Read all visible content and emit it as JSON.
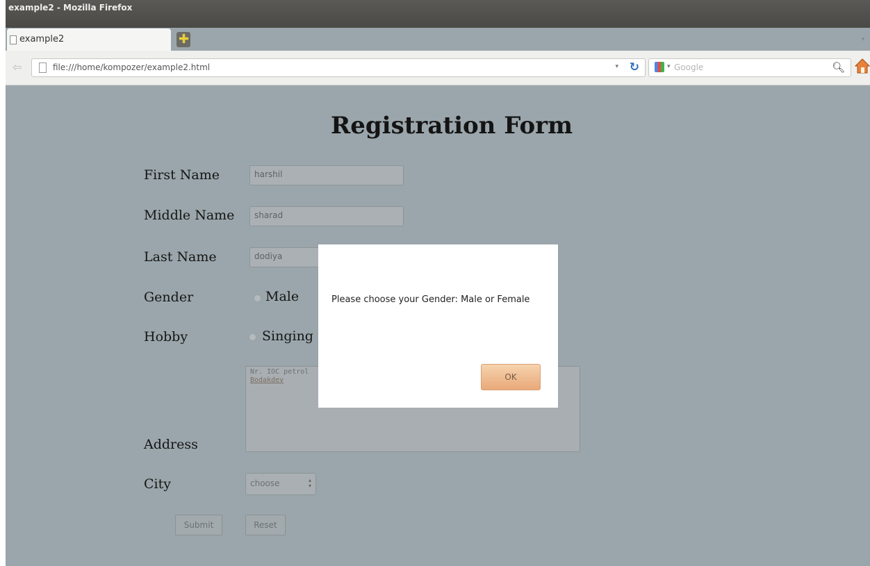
{
  "window": {
    "title": "example2 - Mozilla Firefox"
  },
  "tabs": [
    {
      "label": "example2",
      "active": true
    }
  ],
  "navbar": {
    "url": "file:///home/kompozer/example2.html",
    "search_placeholder": "Google"
  },
  "form": {
    "heading": "Registration Form",
    "first_name": {
      "label": "First Name",
      "value": "harshil"
    },
    "middle_name": {
      "label": "Middle Name",
      "value": "sharad"
    },
    "last_name": {
      "label": "Last Name",
      "value": "dodiya"
    },
    "gender": {
      "label": "Gender",
      "options": [
        "Male"
      ]
    },
    "hobby": {
      "label": "Hobby",
      "options": [
        "Singing"
      ]
    },
    "address": {
      "label": "Address",
      "line1": "Nr. IOC petrol",
      "line2": "Bodakdev"
    },
    "city": {
      "label": "City",
      "selected": "choose"
    },
    "submit_label": "Submit",
    "reset_label": "Reset"
  },
  "alert": {
    "message": "Please choose your Gender: Male or Female",
    "ok_label": "OK"
  },
  "icons": {
    "back": "back-arrow-icon",
    "reload": "reload-icon",
    "search": "magnifier-icon",
    "home": "home-icon",
    "new_tab": "plus-icon"
  },
  "colors": {
    "dialog_ok": "#e9a97a",
    "page_overlay": "#9aa6ab",
    "titlebar": "#4f4e4a"
  }
}
